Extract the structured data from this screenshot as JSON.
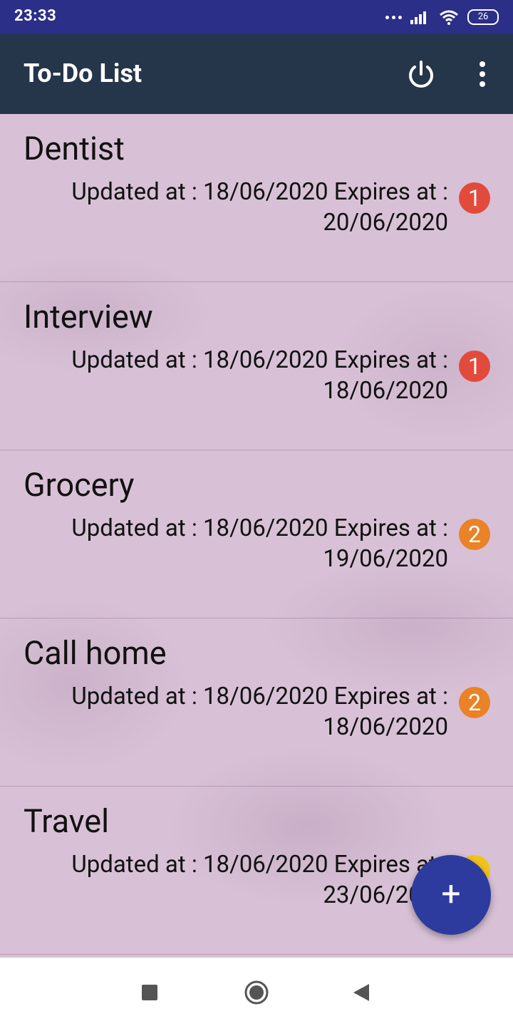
{
  "status_bar": {
    "time": "23:33",
    "battery": "26",
    "icons": [
      "more-dots-icon",
      "signal-icon",
      "wifi-icon",
      "battery-icon"
    ]
  },
  "app_bar": {
    "title": "To-Do List",
    "background": "#25354a",
    "icons": [
      "power-icon",
      "overflow-menu-icon"
    ]
  },
  "tasks": [
    {
      "title": "Dentist",
      "updated": "Updated at : 18/06/2020 ",
      "expires": "Expires at : 20/06/2020",
      "priority": "1",
      "priority_color": "#e24b3c"
    },
    {
      "title": "Interview",
      "updated": "Updated at : 18/06/2020 ",
      "expires": "Expires at : 18/06/2020",
      "priority": "1",
      "priority_color": "#e24b3c"
    },
    {
      "title": "Grocery",
      "updated": "Updated at : 18/06/2020 ",
      "expires": "Expires at : 19/06/2020",
      "priority": "2",
      "priority_color": "#ea8227"
    },
    {
      "title": "Call home",
      "updated": "Updated at : 18/06/2020 ",
      "expires": "Expires at : 18/06/2020",
      "priority": "2",
      "priority_color": "#ea8227"
    },
    {
      "title": "Travel",
      "updated": "Updated at : 18/06/2020 ",
      "expires": "Expires at : 23/06/2020",
      "priority": "",
      "priority_color": "#f2c318"
    }
  ],
  "fab": {
    "label": "+",
    "color": "#2e3b9e"
  },
  "nav_bar": {
    "icons": [
      "recent-apps-icon",
      "home-icon",
      "back-icon"
    ]
  }
}
